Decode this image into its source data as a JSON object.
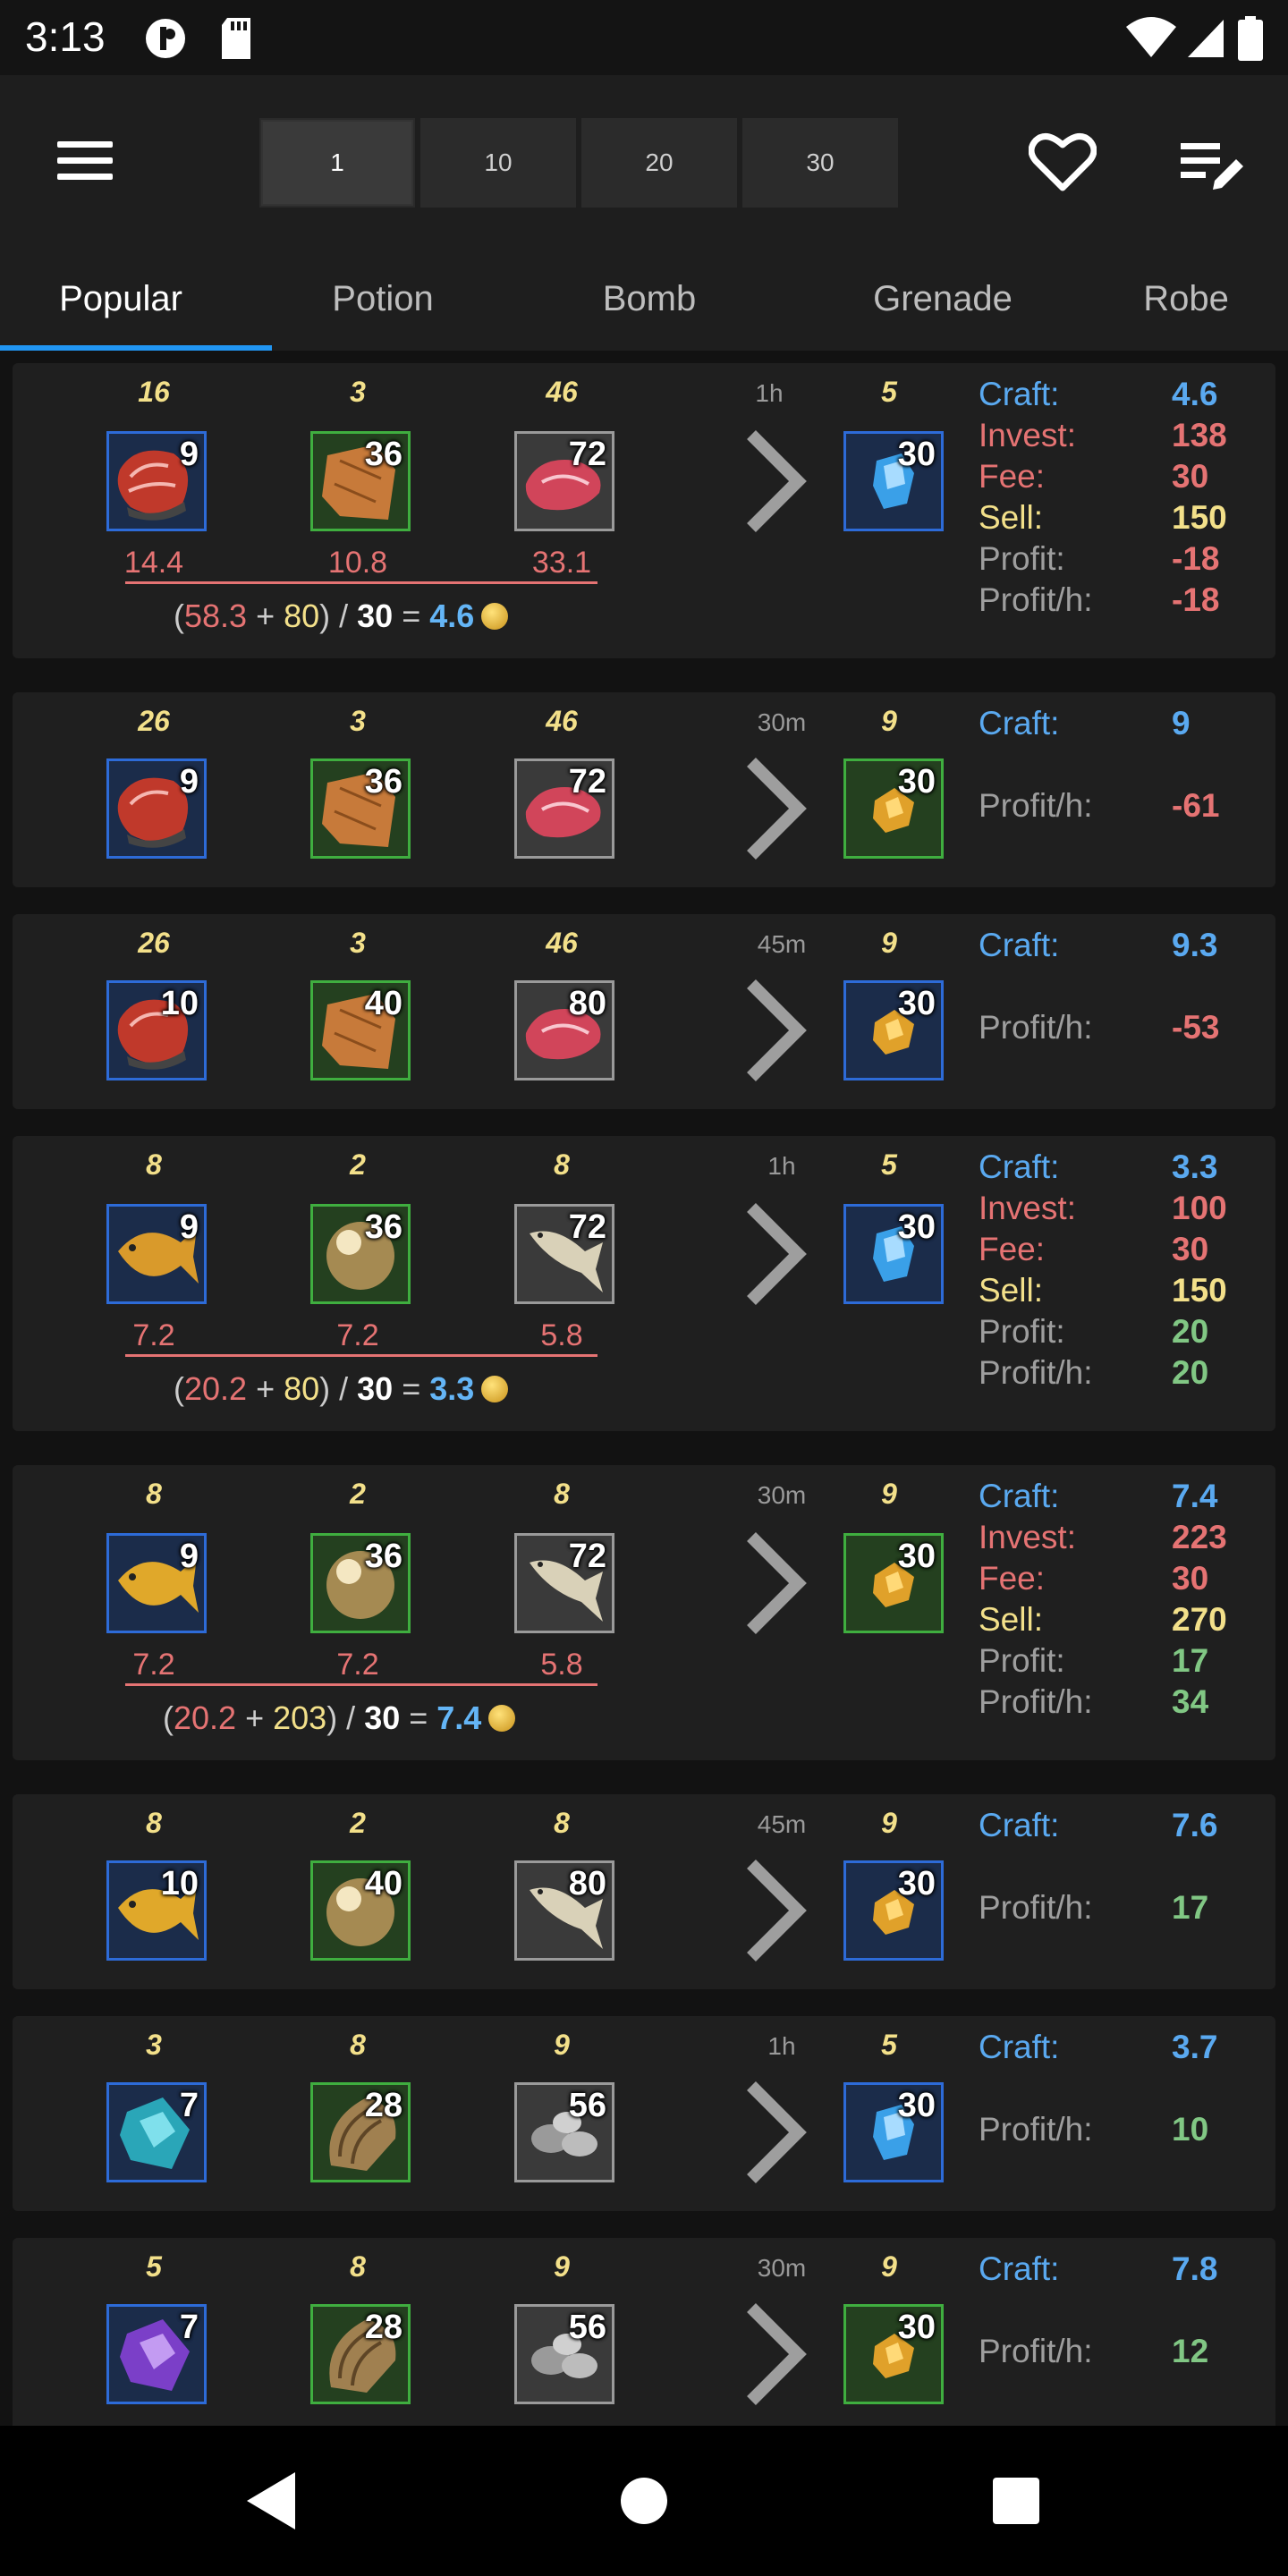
{
  "status_bar": {
    "time": "3:13"
  },
  "toolbar": {
    "quantities": [
      "1",
      "10",
      "20",
      "30"
    ],
    "active_quantity": "1"
  },
  "tabs": [
    "Popular",
    "Potion",
    "Bomb",
    "Grenade",
    "Robe"
  ],
  "active_tab": "Popular",
  "colors": {
    "accent": "#2196f3",
    "craft": "#5aa9f0",
    "negative": "#e57373",
    "positive": "#81c784",
    "sell": "#f3e08a"
  },
  "recipes": [
    {
      "ingredients": [
        {
          "qty": "16",
          "count": "9",
          "icon": "meat-steak-icon",
          "frame": "blue",
          "price": "14.4"
        },
        {
          "qty": "3",
          "count": "36",
          "icon": "leather-hide-icon",
          "frame": "green",
          "price": "10.8"
        },
        {
          "qty": "46",
          "count": "72",
          "icon": "raw-meat-icon",
          "frame": "grey",
          "price": "33.1"
        }
      ],
      "time": "1h",
      "result": {
        "qty": "5",
        "count": "30",
        "icon": "blue-gem-icon",
        "frame": "blue"
      },
      "formula": {
        "a": "58.3",
        "b": "80",
        "div": "30",
        "result": "4.6"
      },
      "stats": [
        {
          "label": "Craft:",
          "value": "4.6",
          "kind": "blue"
        },
        {
          "label": "Invest:",
          "value": "138",
          "kind": "red"
        },
        {
          "label": "Fee:",
          "value": "30",
          "kind": "red"
        },
        {
          "label": "Sell:",
          "value": "150",
          "kind": "yel"
        },
        {
          "label": "Profit:",
          "value": "-18",
          "kind": "grey",
          "vkind": "red"
        },
        {
          "label": "Profit/h:",
          "value": "-18",
          "kind": "grey",
          "vkind": "red"
        }
      ]
    },
    {
      "ingredients": [
        {
          "qty": "26",
          "count": "9",
          "icon": "meat-steak-icon",
          "frame": "blue"
        },
        {
          "qty": "3",
          "count": "36",
          "icon": "leather-hide-icon",
          "frame": "green"
        },
        {
          "qty": "46",
          "count": "72",
          "icon": "raw-meat-icon",
          "frame": "grey"
        }
      ],
      "time": "30m",
      "result": {
        "qty": "9",
        "count": "30",
        "icon": "amber-gem-icon",
        "frame": "green"
      },
      "stats": [
        {
          "label": "Craft:",
          "value": "9",
          "kind": "blue"
        },
        {
          "label": "Profit/h:",
          "value": "-61",
          "kind": "grey",
          "vkind": "red"
        }
      ]
    },
    {
      "ingredients": [
        {
          "qty": "26",
          "count": "10",
          "icon": "meat-steak-icon",
          "frame": "blue"
        },
        {
          "qty": "3",
          "count": "40",
          "icon": "leather-hide-icon",
          "frame": "green"
        },
        {
          "qty": "46",
          "count": "80",
          "icon": "raw-meat-icon",
          "frame": "grey"
        }
      ],
      "time": "45m",
      "result": {
        "qty": "9",
        "count": "30",
        "icon": "amber-gem-icon",
        "frame": "blue"
      },
      "stats": [
        {
          "label": "Craft:",
          "value": "9.3",
          "kind": "blue"
        },
        {
          "label": "Profit/h:",
          "value": "-53",
          "kind": "grey",
          "vkind": "red"
        }
      ]
    },
    {
      "ingredients": [
        {
          "qty": "8",
          "count": "9",
          "icon": "golden-fish-icon",
          "frame": "blue",
          "price": "7.2"
        },
        {
          "qty": "2",
          "count": "36",
          "icon": "pearl-icon",
          "frame": "green",
          "price": "7.2"
        },
        {
          "qty": "8",
          "count": "72",
          "icon": "small-fish-icon",
          "frame": "grey",
          "price": "5.8"
        }
      ],
      "time": "1h",
      "result": {
        "qty": "5",
        "count": "30",
        "icon": "blue-gem-icon",
        "frame": "blue"
      },
      "formula": {
        "a": "20.2",
        "b": "80",
        "div": "30",
        "result": "3.3"
      },
      "stats": [
        {
          "label": "Craft:",
          "value": "3.3",
          "kind": "blue"
        },
        {
          "label": "Invest:",
          "value": "100",
          "kind": "red"
        },
        {
          "label": "Fee:",
          "value": "30",
          "kind": "red"
        },
        {
          "label": "Sell:",
          "value": "150",
          "kind": "yel"
        },
        {
          "label": "Profit:",
          "value": "20",
          "kind": "grey",
          "vkind": "green"
        },
        {
          "label": "Profit/h:",
          "value": "20",
          "kind": "grey",
          "vkind": "green"
        }
      ]
    },
    {
      "ingredients": [
        {
          "qty": "8",
          "count": "9",
          "icon": "golden-fish-icon",
          "frame": "blue",
          "price": "7.2"
        },
        {
          "qty": "2",
          "count": "36",
          "icon": "pearl-icon",
          "frame": "green",
          "price": "7.2"
        },
        {
          "qty": "8",
          "count": "72",
          "icon": "small-fish-icon",
          "frame": "grey",
          "price": "5.8"
        }
      ],
      "time": "30m",
      "result": {
        "qty": "9",
        "count": "30",
        "icon": "amber-gem-icon",
        "frame": "green"
      },
      "formula": {
        "a": "20.2",
        "b": "203",
        "div": "30",
        "result": "7.4"
      },
      "stats": [
        {
          "label": "Craft:",
          "value": "7.4",
          "kind": "blue"
        },
        {
          "label": "Invest:",
          "value": "223",
          "kind": "red"
        },
        {
          "label": "Fee:",
          "value": "30",
          "kind": "red"
        },
        {
          "label": "Sell:",
          "value": "270",
          "kind": "yel"
        },
        {
          "label": "Profit:",
          "value": "17",
          "kind": "grey",
          "vkind": "green"
        },
        {
          "label": "Profit/h:",
          "value": "34",
          "kind": "grey",
          "vkind": "green"
        }
      ]
    },
    {
      "ingredients": [
        {
          "qty": "8",
          "count": "10",
          "icon": "golden-fish-icon",
          "frame": "blue"
        },
        {
          "qty": "2",
          "count": "40",
          "icon": "pearl-icon",
          "frame": "green"
        },
        {
          "qty": "8",
          "count": "80",
          "icon": "small-fish-icon",
          "frame": "grey"
        }
      ],
      "time": "45m",
      "result": {
        "qty": "9",
        "count": "30",
        "icon": "amber-gem-icon",
        "frame": "blue"
      },
      "stats": [
        {
          "label": "Craft:",
          "value": "7.6",
          "kind": "blue"
        },
        {
          "label": "Profit/h:",
          "value": "17",
          "kind": "grey",
          "vkind": "green"
        }
      ]
    },
    {
      "ingredients": [
        {
          "qty": "3",
          "count": "7",
          "icon": "cyan-shard-icon",
          "frame": "blue"
        },
        {
          "qty": "8",
          "count": "28",
          "icon": "wood-bark-icon",
          "frame": "green"
        },
        {
          "qty": "9",
          "count": "56",
          "icon": "ore-rocks-icon",
          "frame": "grey"
        }
      ],
      "time": "1h",
      "result": {
        "qty": "5",
        "count": "30",
        "icon": "blue-gem-icon",
        "frame": "blue"
      },
      "stats": [
        {
          "label": "Craft:",
          "value": "3.7",
          "kind": "blue"
        },
        {
          "label": "Profit/h:",
          "value": "10",
          "kind": "grey",
          "vkind": "green"
        }
      ]
    },
    {
      "ingredients": [
        {
          "qty": "5",
          "count": "7",
          "icon": "purple-shard-icon",
          "frame": "blue"
        },
        {
          "qty": "8",
          "count": "28",
          "icon": "wood-bark-icon",
          "frame": "green"
        },
        {
          "qty": "9",
          "count": "56",
          "icon": "ore-rocks-icon",
          "frame": "grey"
        }
      ],
      "time": "30m",
      "result": {
        "qty": "9",
        "count": "30",
        "icon": "amber-gem-icon",
        "frame": "green"
      },
      "stats": [
        {
          "label": "Craft:",
          "value": "7.8",
          "kind": "blue"
        },
        {
          "label": "Profit/h:",
          "value": "12",
          "kind": "grey",
          "vkind": "green"
        }
      ]
    }
  ]
}
